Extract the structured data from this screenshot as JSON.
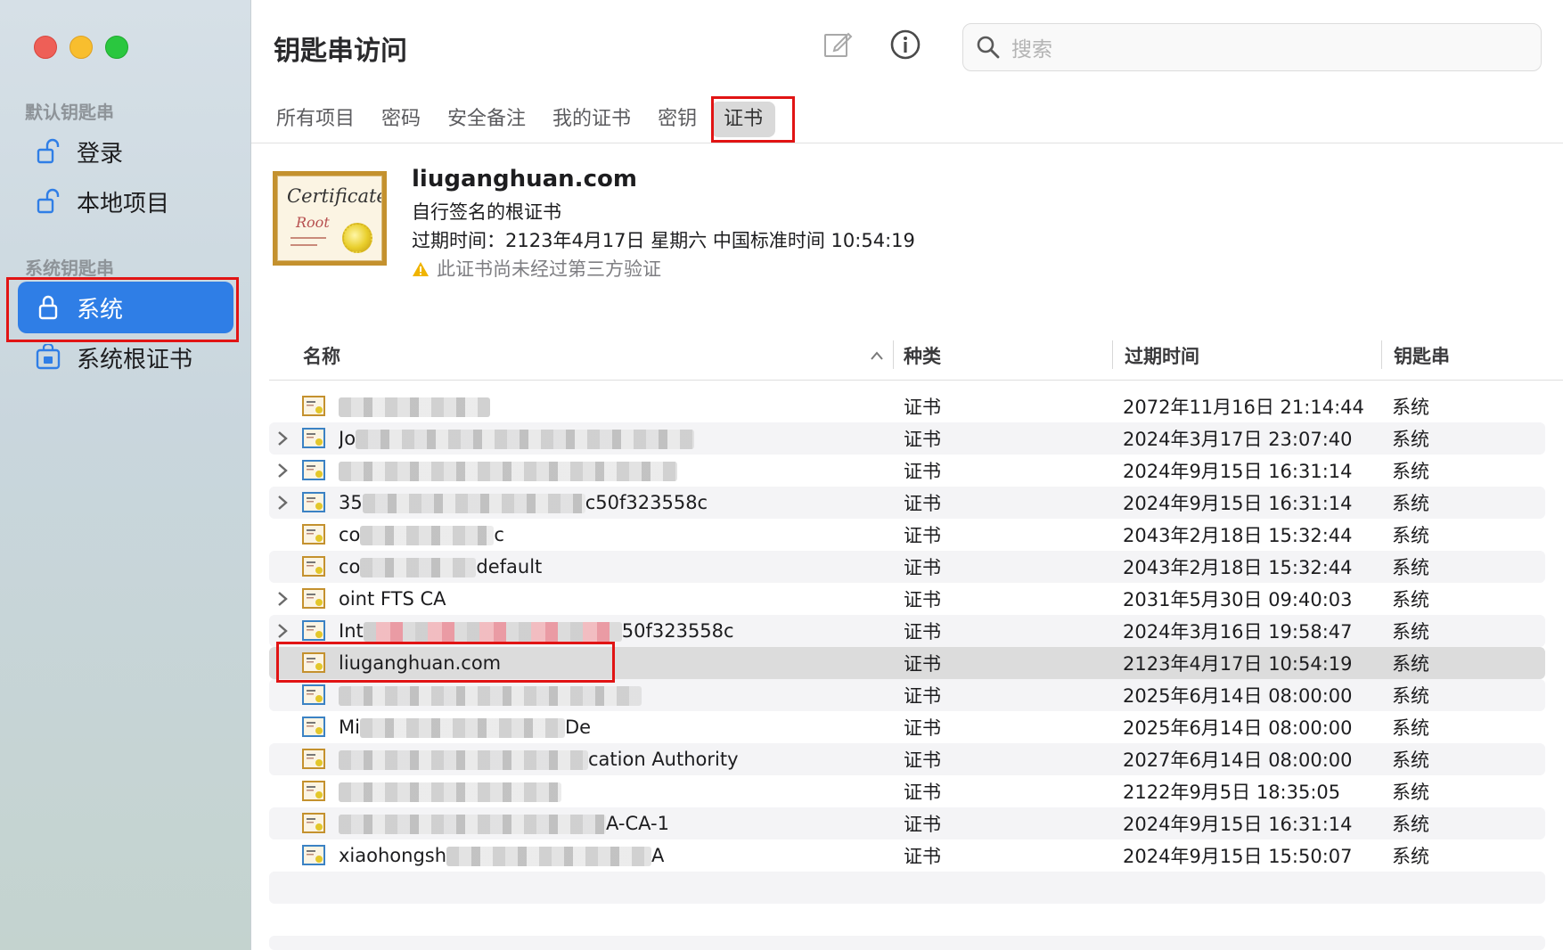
{
  "window": {
    "title": "钥匙串访问"
  },
  "sidebar": {
    "default_header": "默认钥匙串",
    "system_header": "系统钥匙串",
    "items": [
      {
        "label": "登录",
        "icon": "unlock-icon"
      },
      {
        "label": "本地项目",
        "icon": "unlock-icon"
      },
      {
        "label": "系统",
        "icon": "lock-icon",
        "selected": true
      },
      {
        "label": "系统根证书",
        "icon": "cabinet-icon"
      }
    ]
  },
  "toolbar": {
    "compose_icon": "compose-icon",
    "info_icon": "info-icon",
    "search_placeholder": "搜索"
  },
  "tabs": [
    {
      "label": "所有项目"
    },
    {
      "label": "密码"
    },
    {
      "label": "安全备注"
    },
    {
      "label": "我的证书"
    },
    {
      "label": "密钥"
    },
    {
      "label": "证书",
      "active": true
    }
  ],
  "detail": {
    "name": "liuganghuan.com",
    "type": "自行签名的根证书",
    "expires": "过期时间：2123年4月17日 星期六 中国标准时间 10:54:19",
    "warning": "此证书尚未经过第三方验证",
    "cert_text_1": "Certificate",
    "cert_text_2": "Root"
  },
  "table": {
    "columns": [
      "名称",
      "种类",
      "过期时间",
      "钥匙串"
    ],
    "rows": [
      {
        "name_visible": "",
        "kind": "证书",
        "expires": "2072年11月16日 21:14:44",
        "keychain": "系统",
        "expandable": false
      },
      {
        "name_visible": "Jo",
        "kind": "证书",
        "expires": "2024年3月17日 23:07:40",
        "keychain": "系统",
        "expandable": true
      },
      {
        "name_visible": "",
        "kind": "证书",
        "expires": "2024年9月15日 16:31:14",
        "keychain": "系统",
        "expandable": true
      },
      {
        "name_visible": "35",
        "name_tail": "c50f323558c",
        "kind": "证书",
        "expires": "2024年9月15日 16:31:14",
        "keychain": "系统",
        "expandable": true
      },
      {
        "name_visible": "co",
        "name_tail": "c",
        "kind": "证书",
        "expires": "2043年2月18日 15:32:44",
        "keychain": "系统",
        "expandable": false
      },
      {
        "name_visible": "co",
        "name_tail": "default",
        "kind": "证书",
        "expires": "2043年2月18日 15:32:44",
        "keychain": "系统",
        "expandable": false
      },
      {
        "name_visible": "",
        "name_tail": "oint FTS CA",
        "kind": "证书",
        "expires": "2031年5月30日 09:40:03",
        "keychain": "系统",
        "expandable": true
      },
      {
        "name_visible": "Int",
        "name_tail": "50f323558c",
        "kind": "证书",
        "expires": "2024年3月16日 19:58:47",
        "keychain": "系统",
        "expandable": true
      },
      {
        "name_visible": "liuganghuan.com",
        "kind": "证书",
        "expires": "2123年4月17日 10:54:19",
        "keychain": "系统",
        "expandable": false,
        "selected": true
      },
      {
        "name_visible": "",
        "kind": "证书",
        "expires": "2025年6月14日 08:00:00",
        "keychain": "系统",
        "expandable": false
      },
      {
        "name_visible": "Mi",
        "name_tail": "De",
        "kind": "证书",
        "expires": "2025年6月14日 08:00:00",
        "keychain": "系统",
        "expandable": false
      },
      {
        "name_visible": "",
        "name_tail": "cation Authority",
        "kind": "证书",
        "expires": "2027年6月14日 08:00:00",
        "keychain": "系统",
        "expandable": false
      },
      {
        "name_visible": "",
        "kind": "证书",
        "expires": "2122年9月5日 18:35:05",
        "keychain": "系统",
        "expandable": false
      },
      {
        "name_visible": "",
        "name_tail": "A-CA-1",
        "kind": "证书",
        "expires": "2024年9月15日 16:31:14",
        "keychain": "系统",
        "expandable": false
      },
      {
        "name_visible": "xiaohongsh",
        "name_tail": "A",
        "kind": "证书",
        "expires": "2024年9月15日 15:50:07",
        "keychain": "系统",
        "expandable": false
      }
    ]
  },
  "colors": {
    "selection_blue": "#2f7ee6",
    "highlight_red": "#e11414"
  }
}
